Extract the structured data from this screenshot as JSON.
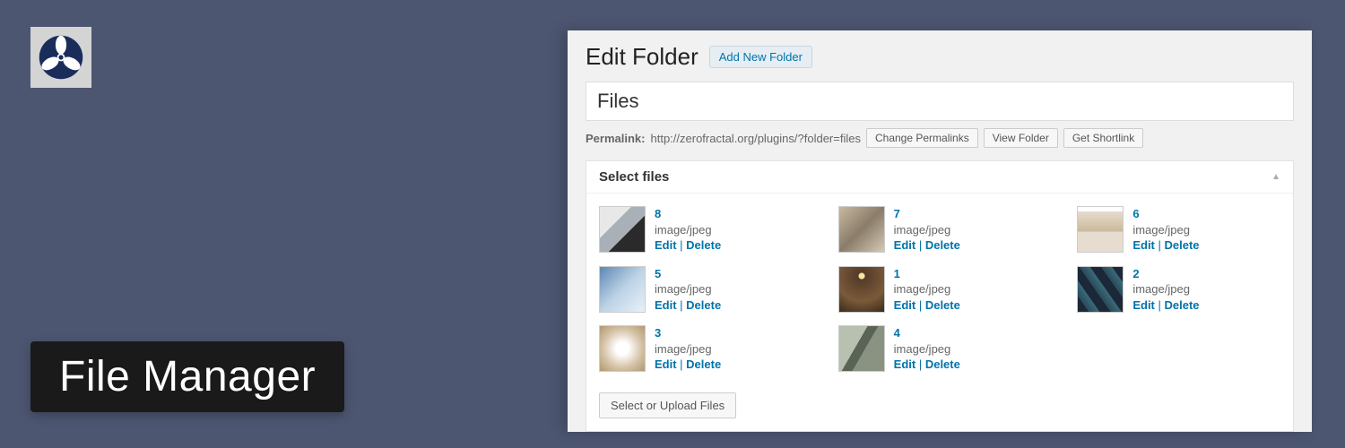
{
  "banner": {
    "title": "File Manager"
  },
  "panel": {
    "heading": "Edit Folder",
    "add_new_label": "Add New Folder",
    "title_value": "Files",
    "permalink_label": "Permalink:",
    "permalink_url": "http://zerofractal.org/plugins/?folder=files",
    "buttons": {
      "change_permalinks": "Change Permalinks",
      "view_folder": "View Folder",
      "get_shortlink": "Get Shortlink"
    }
  },
  "metabox": {
    "title": "Select files",
    "select_upload_label": "Select or Upload Files",
    "edit_label": "Edit",
    "delete_label": "Delete",
    "files": [
      {
        "id": "8",
        "mime": "image/jpeg",
        "thumb_class": "t1"
      },
      {
        "id": "7",
        "mime": "image/jpeg",
        "thumb_class": "t2"
      },
      {
        "id": "6",
        "mime": "image/jpeg",
        "thumb_class": "t3"
      },
      {
        "id": "5",
        "mime": "image/jpeg",
        "thumb_class": "t4"
      },
      {
        "id": "1",
        "mime": "image/jpeg",
        "thumb_class": "t5"
      },
      {
        "id": "2",
        "mime": "image/jpeg",
        "thumb_class": "t6"
      },
      {
        "id": "3",
        "mime": "image/jpeg",
        "thumb_class": "t7"
      },
      {
        "id": "4",
        "mime": "image/jpeg",
        "thumb_class": "t8"
      }
    ]
  }
}
